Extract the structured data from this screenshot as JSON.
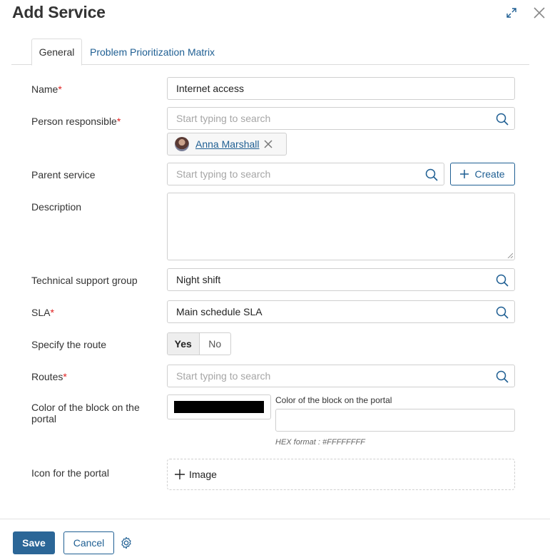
{
  "dialog": {
    "title": "Add Service"
  },
  "tabs": [
    {
      "label": "General",
      "active": true
    },
    {
      "label": "Problem Prioritization Matrix",
      "active": false
    }
  ],
  "fields": {
    "name": {
      "label": "Name",
      "required_mark": "*",
      "value": "Internet access"
    },
    "person_responsible": {
      "label": "Person responsible",
      "required_mark": "*",
      "placeholder": "Start typing to search",
      "selected_user": "Anna Marshall"
    },
    "parent_service": {
      "label": "Parent service",
      "placeholder": "Start typing to search",
      "create_label": "Create"
    },
    "description": {
      "label": "Description",
      "value": ""
    },
    "tech_support_group": {
      "label": "Technical support group",
      "value": "Night shift"
    },
    "sla": {
      "label": "SLA",
      "required_mark": "*",
      "value": "Main schedule SLA"
    },
    "specify_route": {
      "label": "Specify the route",
      "options": [
        "Yes",
        "No"
      ],
      "selected": "Yes"
    },
    "routes": {
      "label": "Routes",
      "required_mark": "*",
      "placeholder": "Start typing to search"
    },
    "block_color": {
      "label": "Color of the block on the portal",
      "picker_label": "Color of the block on the portal",
      "hex_value": "",
      "hint": "HEX format : #FFFFFFFF",
      "swatch_color": "#000000"
    },
    "portal_icon": {
      "label": "Icon for the portal",
      "add_label": "Image"
    }
  },
  "footer": {
    "save_label": "Save",
    "cancel_label": "Cancel"
  },
  "colors": {
    "accent": "#1f5f93",
    "save_bg": "#2b6697",
    "required": "#e02020"
  },
  "icons": [
    "expand-icon",
    "close-icon",
    "search-icon",
    "remove-icon",
    "plus-icon",
    "gear-icon"
  ]
}
